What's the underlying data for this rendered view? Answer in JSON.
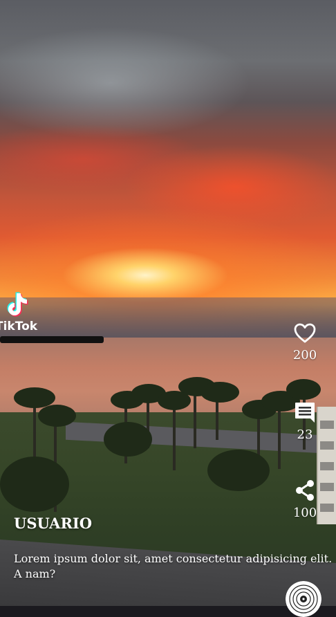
{
  "brand": {
    "name": "TikTok"
  },
  "sidebar": {
    "like": {
      "icon": "heart-icon",
      "count": "200"
    },
    "comment": {
      "icon": "comment-icon",
      "count": "23"
    },
    "share": {
      "icon": "share-icon",
      "count": "100"
    }
  },
  "post": {
    "username": "USUARIO",
    "description": "Lorem ipsum dolor sit, amet consectetur adipisicing elit. A nam?"
  },
  "music": {
    "icon": "vinyl-disc-icon"
  }
}
